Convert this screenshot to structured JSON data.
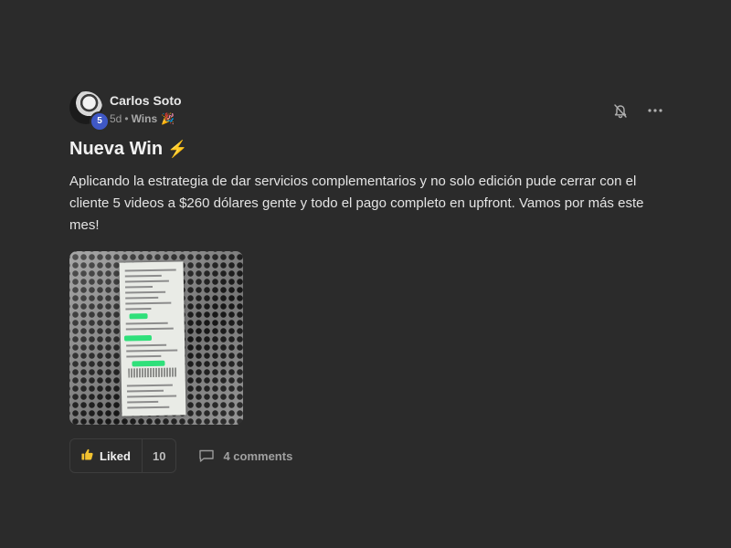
{
  "post": {
    "author": "Carlos Soto",
    "level": "5",
    "time_ago": "5d",
    "separator": "•",
    "category": "Wins",
    "category_emoji": "🎉",
    "title": "Nueva Win",
    "title_emoji": "⚡",
    "body": "Aplicando la estrategia de dar servicios complementarios y no solo edición pude cerrar con el cliente 5 videos a $260 dólares gente y todo el pago completo en upfront. Vamos por más este mes!",
    "image_icon": "receipt-photo"
  },
  "header_actions": {
    "notification_icon": "bell-off-icon",
    "more_icon": "more-options-icon"
  },
  "actions": {
    "like_label": "Liked",
    "like_icon": "thumbs-up-icon",
    "like_count": "10",
    "comments_label": "4 comments",
    "comments_icon": "comment-icon"
  },
  "colors": {
    "background": "#2b2b2b",
    "level_badge": "#3f58c6",
    "like_icon": "#f2c230",
    "bolt": "#ff8a3c"
  }
}
